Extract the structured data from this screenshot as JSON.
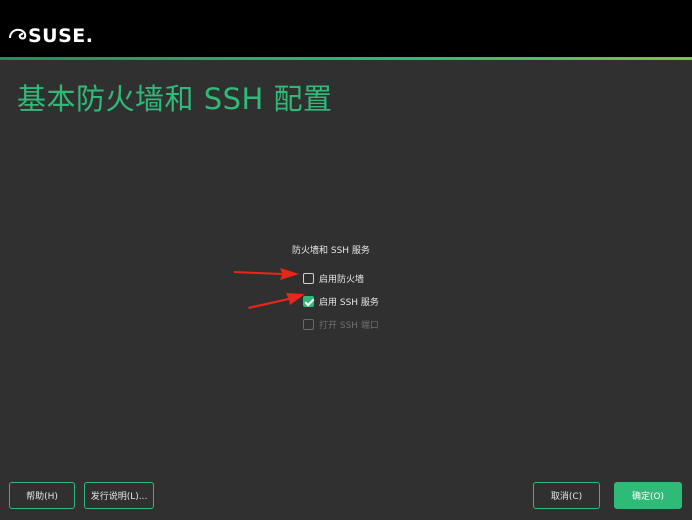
{
  "header": {
    "logo_text": "SUSE."
  },
  "page": {
    "title": "基本防火墙和 SSH 配置"
  },
  "group": {
    "title": "防火墙和 SSH 服务",
    "options": [
      {
        "label": "启用防火墙",
        "checked": false,
        "enabled": true
      },
      {
        "label": "启用 SSH 服务",
        "checked": true,
        "enabled": true
      },
      {
        "label": "打开 SSH 端口",
        "checked": false,
        "enabled": false
      }
    ]
  },
  "buttons": {
    "help": "帮助(H)",
    "release_notes": "发行说明(L)...",
    "cancel": "取消(C)",
    "ok": "确定(O)"
  },
  "colors": {
    "accent": "#30ba78",
    "background": "#303030",
    "arrow": "#e8261a"
  }
}
